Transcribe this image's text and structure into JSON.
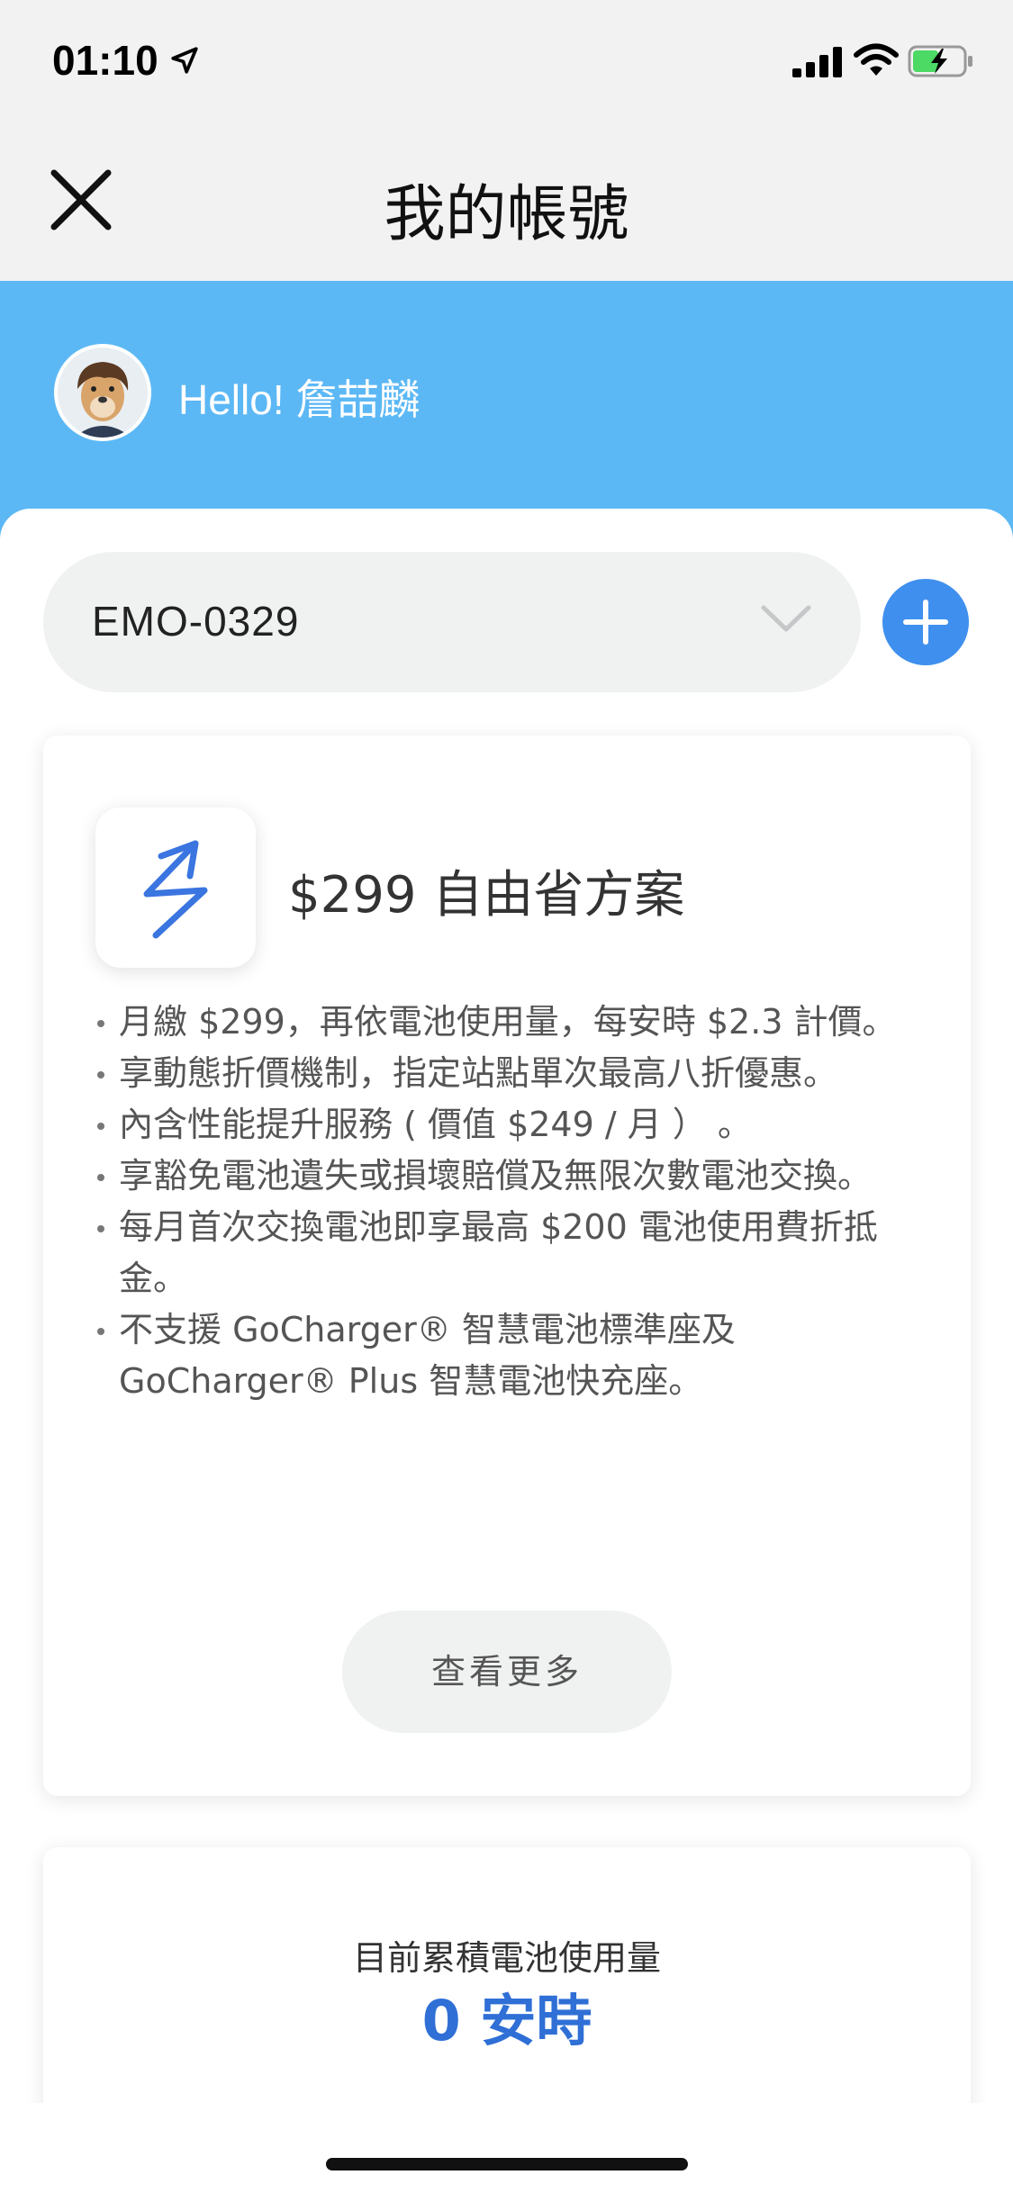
{
  "status_bar": {
    "time": "01:10",
    "icons": [
      "location-arrow-icon",
      "cellular-signal-icon",
      "wifi-icon",
      "battery-charging-icon"
    ]
  },
  "nav": {
    "title": "我的帳號",
    "close_icon": "close-icon"
  },
  "profile": {
    "greeting": "Hello! 詹喆麟",
    "avatar_icon": "user-avatar"
  },
  "vehicle": {
    "selected": "EMO-0329",
    "dropdown_icon": "chevron-down-icon",
    "add_icon": "plus-icon"
  },
  "plan": {
    "icon": "gogoro-plan-icon",
    "title": "$299 自由省方案",
    "features": [
      "月繳 $299，再依電池使用量，每安時 $2.3 計價。",
      "享動態折價機制，指定站點單次最高八折優惠。",
      "內含性能提升服務 ( 價值 $249 / 月 ） 。",
      "享豁免電池遺失或損壞賠償及無限次數電池交換。",
      "每月首次交換電池即享最高 $200 電池使用費折抵金。",
      "不支援 GoCharger® 智慧電池標準座及 GoCharger® Plus 智慧電池快充座。"
    ],
    "more_label": "查看更多"
  },
  "usage": {
    "label": "目前累積電池使用量",
    "value": "0 安時"
  },
  "colors": {
    "hero_bg": "#5cb8f5",
    "accent_blue": "#3f8fee",
    "usage_blue": "#2f6fd6"
  }
}
